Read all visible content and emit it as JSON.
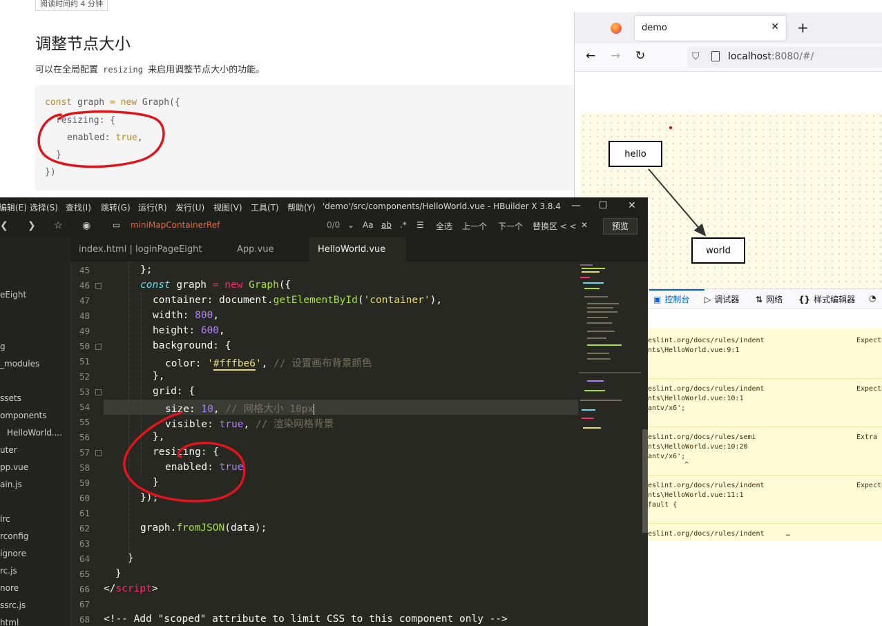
{
  "doc": {
    "read_time": "阅读时间约 4 分钟",
    "heading": "调整节点大小",
    "intro_before": "可以在全局配置 ",
    "intro_code": "resizing",
    "intro_after": " 来启用调整节点大小的功能。",
    "code": {
      "l1_kw": "const",
      "l1_var": " graph ",
      "l1_eq": "=",
      "l1_new": " new",
      "l1_cls": " Graph({",
      "l2": "resizing: {",
      "l3_key": "enabled: ",
      "l3_val": "true",
      "l3_comma": ",",
      "l4": "}",
      "l5": "})"
    }
  },
  "firefox": {
    "tab_title": "demo",
    "tab_close": "✕",
    "new_tab": "+",
    "nav_back": "←",
    "nav_forward": "→",
    "nav_reload": "↻",
    "url_host": "localhost",
    "url_rest": ":8080/#/",
    "nodes": {
      "hello": "hello",
      "world": "world"
    },
    "devtools_tabs": [
      {
        "icon": "▣",
        "label": "控制台"
      },
      {
        "icon": "▷",
        "label": "调试器"
      },
      {
        "icon": "⇅",
        "label": "网络"
      },
      {
        "icon": "{}",
        "label": "样式编辑器"
      },
      {
        "icon": "◔",
        "label": ""
      }
    ],
    "console": [
      {
        "a": "eslint.org/docs/rules/indent",
        "b": "nts\\HelloWorld.vue:9:1",
        "c": "",
        "d": "",
        "right": "Expecte"
      },
      {
        "a": "eslint.org/docs/rules/indent",
        "b": "nts\\HelloWorld.vue:10:1",
        "c": "antv/x6';",
        "d": "",
        "right": "Expecte"
      },
      {
        "a": "eslint.org/docs/rules/semi",
        "b": "nts\\HelloWorld.vue:10:20",
        "c": "antv/x6';",
        "d": "^",
        "right": "Extra s"
      },
      {
        "a": "eslint.org/docs/rules/indent",
        "b": "nts\\HelloWorld.vue:11:1",
        "c": "fault {",
        "d": "",
        "right": "Expecte"
      },
      {
        "a": "eslint.org/docs/rules/indent",
        "b": "…",
        "c": "",
        "d": "",
        "right": ""
      }
    ]
  },
  "hbuilder": {
    "menus": [
      "编辑(E)",
      "选择(S)",
      "查找(I)",
      "跳转(G)",
      "运行(R)",
      "发行(U)",
      "视图(V)",
      "工具(T)",
      "帮助(Y)"
    ],
    "title": "'demo'/src/components/HelloWorld.vue - HBuilder X 3.8.4",
    "win_min": "—",
    "win_max": "☐",
    "win_close": "✕",
    "search_query": "miniMapContainerRef",
    "search_count": "0/0",
    "search_case": "Aa",
    "search_word": "ab",
    "search_regex": ".*",
    "select_all": "全选",
    "prev": "上一个",
    "next": "下一个",
    "replace": "替换区 < <",
    "search_close": "✕",
    "preview": "预览",
    "tabs": [
      "index.html | loginPageEight",
      "App.vue",
      "HelloWorld.vue"
    ],
    "sidebar": [
      "eEight",
      "g",
      "_modules",
      "ssets",
      "omponents",
      "HelloWorld....",
      "uter",
      "pp.vue",
      "ain.js",
      "lrc",
      "rconfig",
      "ignore",
      "rc.js",
      "nore",
      "ssrc.js",
      "html"
    ],
    "line_numbers": [
      "45",
      "46",
      "47",
      "48",
      "49",
      "50",
      "51",
      "52",
      "53",
      "54",
      "55",
      "56",
      "57",
      "58",
      "59",
      "60",
      "61",
      "62",
      "63",
      "64",
      "65",
      "66",
      "67",
      "68"
    ],
    "code": {
      "l45": "};",
      "l46_kw": "const",
      "l46_var": " graph ",
      "l46_eq": "=",
      "l46_new": " new",
      "l46_cls": " Graph",
      "l46_tail": "({",
      "l47_key": "container: document.",
      "l47_fn": "getElementById",
      "l47_open": "(",
      "l47_str": "'container'",
      "l47_close": "),",
      "l48_key": "width: ",
      "l48_num": "800",
      "l48_comma": ",",
      "l49_key": "height: ",
      "l49_num": "600",
      "l49_comma": ",",
      "l50": "background: {",
      "l51_key": "color: ",
      "l51_q1": "'",
      "l51_str": "#fffbe6",
      "l51_q2": "'",
      "l51_comma": ", ",
      "l51_cm": "// 设置画布背景颜色",
      "l52": "},",
      "l53": "grid: {",
      "l54_key": "size: ",
      "l54_num": "10",
      "l54_comma": ", ",
      "l54_cm": "// 网格大小 10px",
      "l55_key": "visible: ",
      "l55_val": "true",
      "l55_comma": ", ",
      "l55_cm": "// 渲染网格背景",
      "l56": "},",
      "l57": "resizing: {",
      "l58_key": "enabled: ",
      "l58_val": "true",
      "l59": "}",
      "l60": "});",
      "l62_a": "graph.",
      "l62_fn": "fromJSON",
      "l62_b": "(data);",
      "l64": "}",
      "l65": "}",
      "l66_a": "</",
      "l66_tag": "script",
      "l66_b": ">",
      "l68": "<!-- Add \"scoped\" attribute to limit CSS to this component only -->"
    }
  }
}
